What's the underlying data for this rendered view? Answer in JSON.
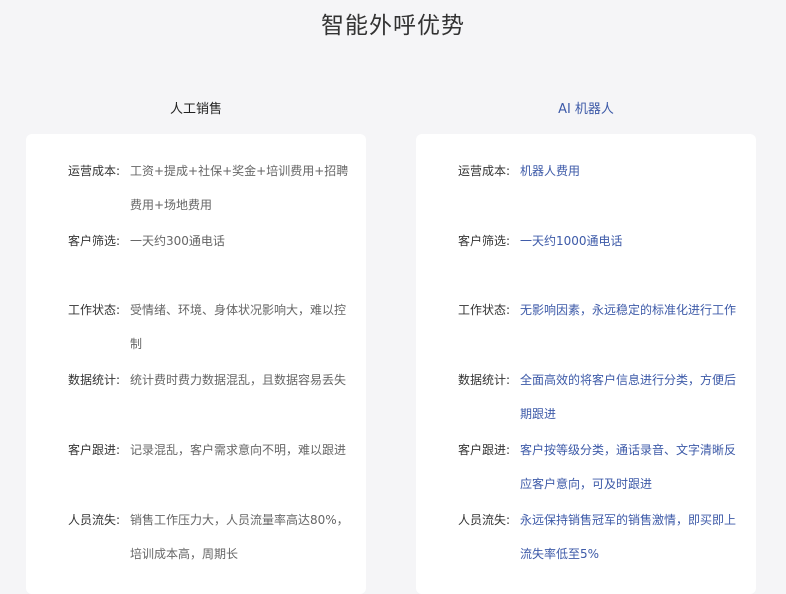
{
  "page_title": "智能外呼优势",
  "columns": [
    {
      "title": "人工销售",
      "rows": [
        {
          "label": "运营成本:",
          "value": "工资+提成+社保+奖金+培训费用+招聘费用+场地费用"
        },
        {
          "label": "客户筛选:",
          "value": "一天约300通电话"
        },
        {
          "label": "工作状态:",
          "value": "受情绪、环境、身体状况影响大，难以控制"
        },
        {
          "label": "数据统计:",
          "value": "统计费时费力数据混乱，且数据容易丢失"
        },
        {
          "label": "客户跟进:",
          "value": "记录混乱，客户需求意向不明，难以跟进"
        },
        {
          "label": "人员流失:",
          "value": "销售工作压力大，人员流量率高达80%，培训成本高，周期长"
        }
      ]
    },
    {
      "title": "AI 机器人",
      "rows": [
        {
          "label": "运营成本:",
          "value": "机器人费用"
        },
        {
          "label": "客户筛选:",
          "value": "一天约1000通电话"
        },
        {
          "label": "工作状态:",
          "value": "无影响因素，永远稳定的标准化进行工作"
        },
        {
          "label": "数据统计:",
          "value": "全面高效的将客户信息进行分类，方便后期跟进"
        },
        {
          "label": "客户跟进:",
          "value": "客户按等级分类，通话录音、文字清晰反应客户意向，可及时跟进"
        },
        {
          "label": "人员流失:",
          "value": "永远保持销售冠军的销售激情，即买即上流失率低至5%"
        }
      ]
    }
  ]
}
